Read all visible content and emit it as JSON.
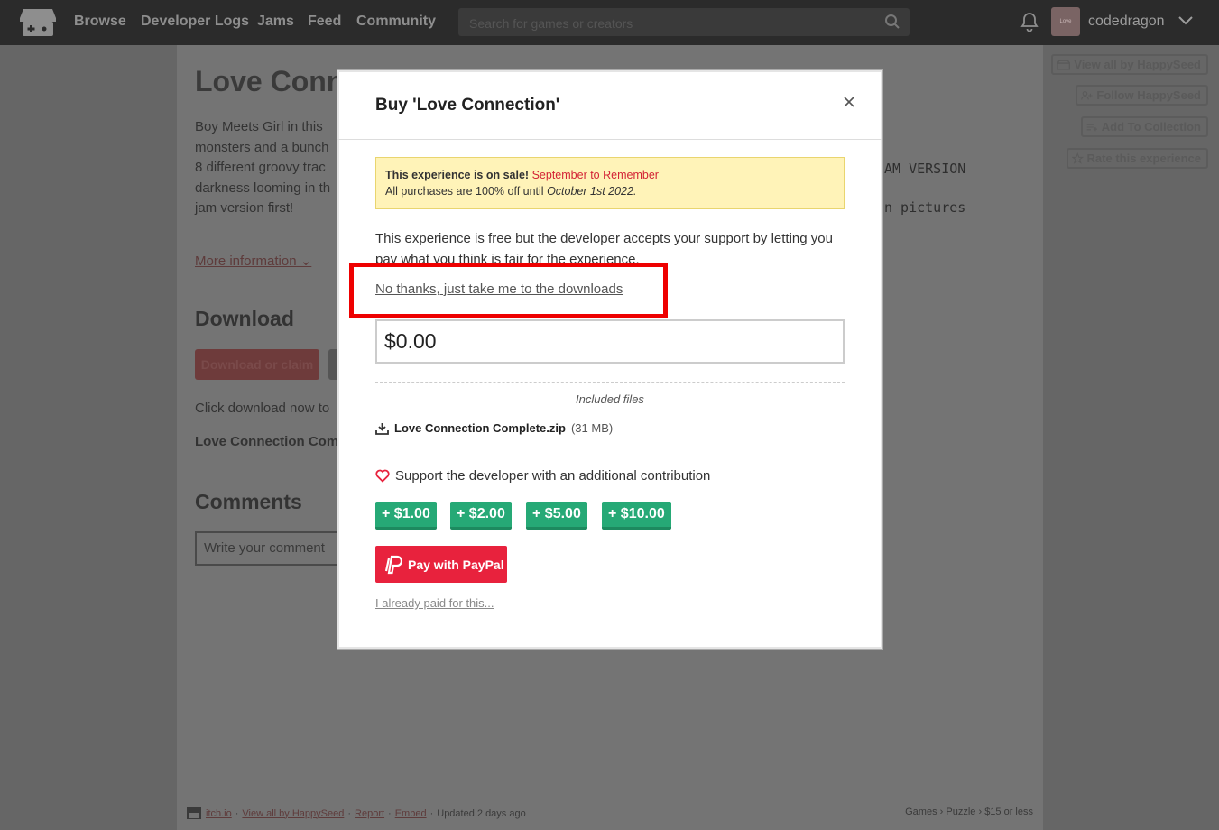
{
  "nav": {
    "links": [
      "Browse",
      "Developer Logs",
      "Jams",
      "Feed",
      "Community"
    ],
    "search_placeholder": "Search for games or creators",
    "avatar_text": "Love Connection",
    "username": "codedragon"
  },
  "background": {
    "title": "Love Conne",
    "description": "Boy Meets Girl in this monsters and a bunch 8 different groovy trac darkness looming in th jam version first!",
    "more_info": "More information",
    "download_heading": "Download",
    "download_button": "Download or claim",
    "click_download": "Click download now to",
    "file_name": "Love Connection Com",
    "comments_heading": "Comments",
    "comment_placeholder": "Write your comment",
    "mono_line1": "AM VERSION",
    "mono_line2": "n pictures",
    "side_buttons": [
      "View all by HappySeed",
      "Follow HappySeed",
      "Add To Collection",
      "Rate this experience"
    ]
  },
  "footer": {
    "site": "itch.io",
    "links": [
      "View all by HappySeed",
      "Report",
      "Embed"
    ],
    "updated": "Updated 2 days ago",
    "tags": [
      "Games",
      "Puzzle",
      "$15 or less"
    ]
  },
  "modal": {
    "title": "Buy 'Love Connection'",
    "sale_prefix": "This experience is on sale!",
    "sale_link": "September to Remember",
    "sale_line2_prefix": "All purchases are 100% off until",
    "sale_date": "October 1st 2022.",
    "free_text": "This experience is free but the developer accepts your support by letting you pay what you think is fair for the experience.",
    "no_thanks": "No thanks, just take me to the downloads",
    "price_value": "$0.00",
    "included_files_label": "Included files",
    "file_name": "Love Connection Complete.zip",
    "file_size": "(31 MB)",
    "support_text": "Support the developer with an additional contribution",
    "tip_buttons": [
      "$1.00",
      "$2.00",
      "$5.00",
      "$10.00"
    ],
    "paypal_label": "Pay with PayPal",
    "already_paid": "I already paid for this..."
  },
  "colors": {
    "accent_red": "#ee0000",
    "sale_link": "#d32335",
    "tip_green": "#26a976",
    "paypal_red": "#e8223d"
  }
}
